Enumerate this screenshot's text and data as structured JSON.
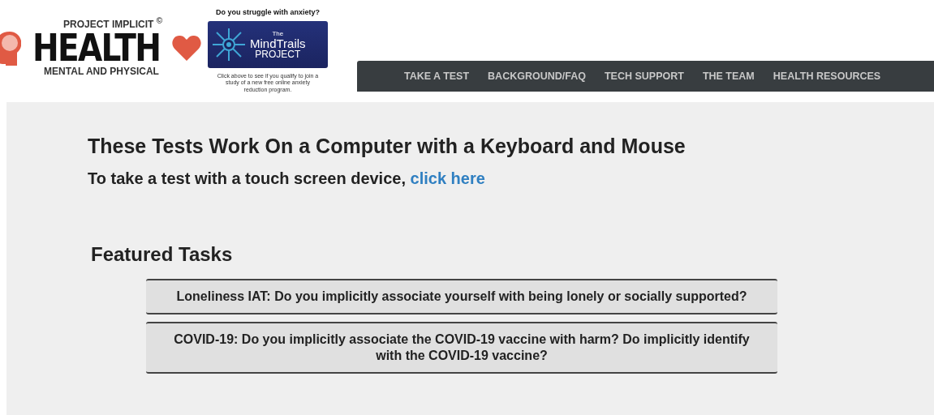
{
  "logo": {
    "top": "PROJECT IMPLICIT $^{©}$",
    "title": "HEALTH",
    "subtitle": "MENTAL AND PHYSICAL"
  },
  "promo": {
    "question": "Do you struggle with anxiety?",
    "banner_top": "The",
    "banner_main": "MindTrails",
    "banner_bottom": "PROJECT",
    "caption": "Click above to see if you qualify to join a study of a new free online anxiety reduction program."
  },
  "nav": [
    "TAKE A TEST",
    "BACKGROUND/FAQ",
    "TECH SUPPORT",
    "THE TEAM",
    "HEALTH RESOURCES"
  ],
  "heading": "These Tests Work On a Computer with a Keyboard and Mouse",
  "touch": {
    "text": "To take a test with a touch screen device,",
    "link": "click here"
  },
  "featured_title": "Featured Tasks",
  "tasks": [
    "Loneliness IAT: Do you implicitly associate yourself with being lonely or socially supported?",
    "COVID-19: Do you implicitly associate the COVID-19 vaccine with harm? Do implicitly identify with the COVID-19 vaccine?"
  ]
}
